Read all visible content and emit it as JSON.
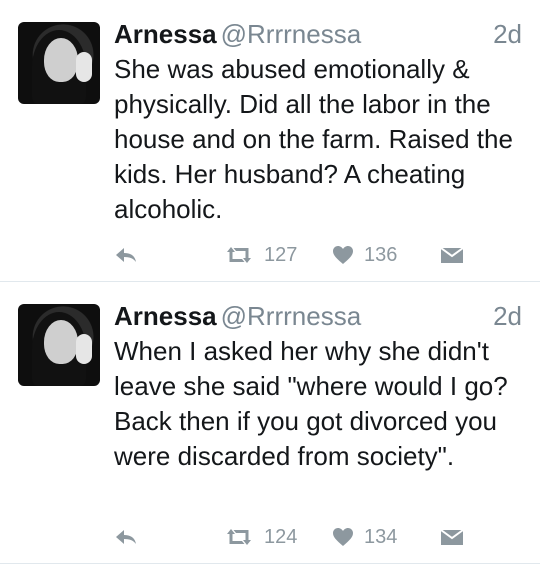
{
  "tweets": [
    {
      "name": "Arnessa",
      "handle": "@Rrrrnessa",
      "time": "2d",
      "text": "She was abused emotionally & physically. Did all the labor in the house and on the farm. Raised the kids. Her husband? A cheating alcoholic.",
      "retweets": "127",
      "likes": "136"
    },
    {
      "name": "Arnessa",
      "handle": "@Rrrrnessa",
      "time": "2d",
      "text": "When I asked her why she didn't leave she said \"where would I go? Back then if you got divorced you were discarded from society\".",
      "retweets": "124",
      "likes": "134"
    }
  ],
  "colors": {
    "text": "#14171a",
    "muted": "#7a8791",
    "icon": "#8d989f",
    "divider": "#e1e8ed"
  },
  "icons": [
    "reply-icon",
    "retweet-icon",
    "heart-icon",
    "envelope-icon"
  ]
}
